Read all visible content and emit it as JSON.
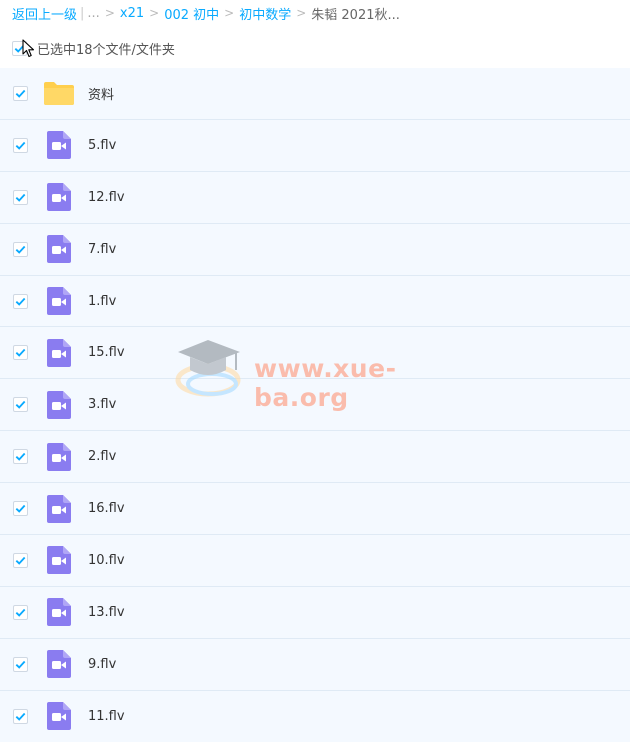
{
  "breadcrumb": {
    "back": "返回上一级",
    "ellipsis": "...",
    "items": [
      "x21",
      "002 初中",
      "初中数学"
    ],
    "current": "朱韬 2021秋..."
  },
  "selection": {
    "label": "已选中18个文件/文件夹"
  },
  "files": [
    {
      "name": "资料",
      "type": "folder"
    },
    {
      "name": "5.flv",
      "type": "video"
    },
    {
      "name": "12.flv",
      "type": "video"
    },
    {
      "name": "7.flv",
      "type": "video"
    },
    {
      "name": "1.flv",
      "type": "video"
    },
    {
      "name": "15.flv",
      "type": "video"
    },
    {
      "name": "3.flv",
      "type": "video"
    },
    {
      "name": "2.flv",
      "type": "video"
    },
    {
      "name": "16.flv",
      "type": "video"
    },
    {
      "name": "10.flv",
      "type": "video"
    },
    {
      "name": "13.flv",
      "type": "video"
    },
    {
      "name": "9.flv",
      "type": "video"
    },
    {
      "name": "11.flv",
      "type": "video"
    }
  ],
  "watermark": {
    "text": "www.xue-ba.org"
  },
  "colors": {
    "link": "#09aaff",
    "check": "#09aaff",
    "video": "#8a7cf0",
    "folder": "#ffd25a",
    "row_bg": "#f4f9ff"
  }
}
